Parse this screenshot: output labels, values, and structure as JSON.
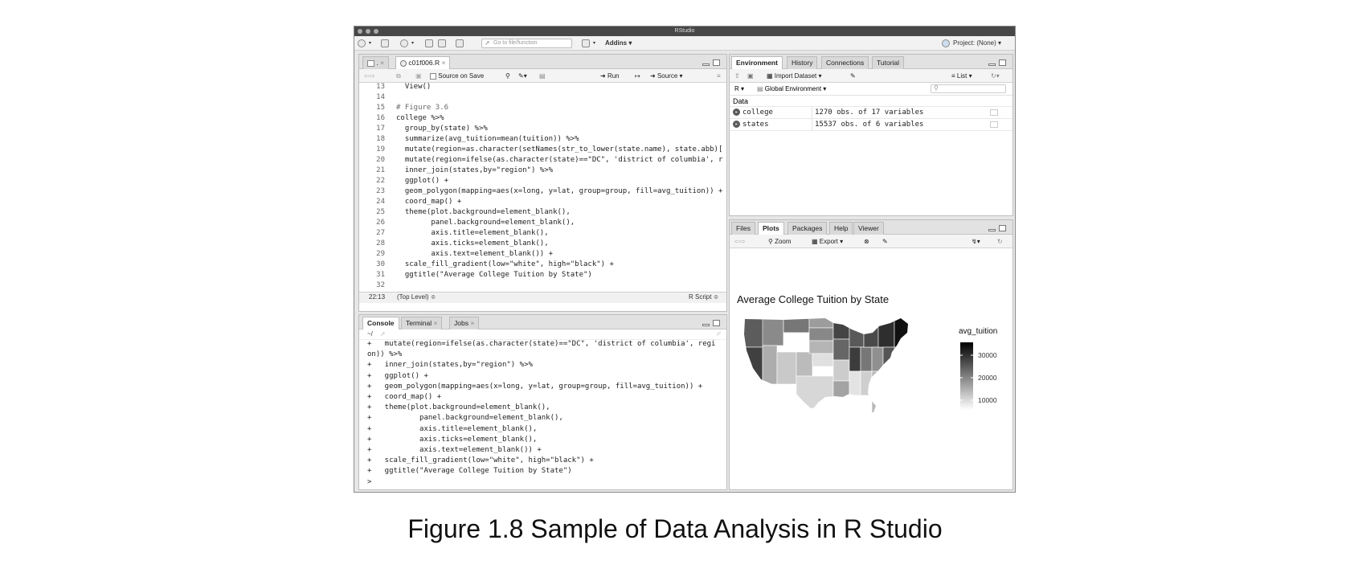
{
  "window_title": "RStudio",
  "toolbar": {
    "go_to_placeholder": "Go to file/function",
    "addins": "Addins",
    "project": "Project: (None)"
  },
  "source_pane": {
    "tabs": [
      ".",
      "c01f006.R"
    ],
    "source_on_save": "Source on Save",
    "run": "Run",
    "source": "Source",
    "lines": [
      {
        "n": "13",
        "t": "  View()"
      },
      {
        "n": "14",
        "t": ""
      },
      {
        "n": "15",
        "t": "# Figure 3.6"
      },
      {
        "n": "16",
        "t": "college %>%"
      },
      {
        "n": "17",
        "t": "  group_by(state) %>%"
      },
      {
        "n": "18",
        "t": "  summarize(avg_tuition=mean(tuition)) %>%"
      },
      {
        "n": "19",
        "t": "  mutate(region=as.character(setNames(str_to_lower(state.name), state.abb)["
      },
      {
        "n": "20",
        "t": "  mutate(region=ifelse(as.character(state)==\"DC\", 'district of columbia', r"
      },
      {
        "n": "21",
        "t": "  inner_join(states,by=\"region\") %>%"
      },
      {
        "n": "22",
        "t": "  ggplot() +"
      },
      {
        "n": "23",
        "t": "  geom_polygon(mapping=aes(x=long, y=lat, group=group, fill=avg_tuition)) +"
      },
      {
        "n": "24",
        "t": "  coord_map() +"
      },
      {
        "n": "25",
        "t": "  theme(plot.background=element_blank(),"
      },
      {
        "n": "26",
        "t": "        panel.background=element_blank(),"
      },
      {
        "n": "27",
        "t": "        axis.title=element_blank(),"
      },
      {
        "n": "28",
        "t": "        axis.ticks=element_blank(),"
      },
      {
        "n": "29",
        "t": "        axis.text=element_blank()) +"
      },
      {
        "n": "30",
        "t": "  scale_fill_gradient(low=\"white\", high=\"black\") +"
      },
      {
        "n": "31",
        "t": "  ggtitle(\"Average College Tuition by State\")"
      },
      {
        "n": "32",
        "t": ""
      }
    ],
    "cursor_pos": "22:13",
    "scope": "(Top Level) ≑",
    "file_type": "R Script ≑"
  },
  "console_pane": {
    "tabs": [
      "Console",
      "Terminal",
      "Jobs"
    ],
    "path": "~/",
    "lines": [
      "+   mutate(region=ifelse(as.character(state)==\"DC\", 'district of columbia', regi",
      "on)) %>%",
      "+   inner_join(states,by=\"region\") %>%",
      "+   ggplot() +",
      "+   geom_polygon(mapping=aes(x=long, y=lat, group=group, fill=avg_tuition)) +",
      "+   coord_map() +",
      "+   theme(plot.background=element_blank(),",
      "+           panel.background=element_blank(),",
      "+           axis.title=element_blank(),",
      "+           axis.ticks=element_blank(),",
      "+           axis.text=element_blank()) +",
      "+   scale_fill_gradient(low=\"white\", high=\"black\") +",
      "+   ggtitle(\"Average College Tuition by State\")",
      ">"
    ]
  },
  "env_pane": {
    "tabs": [
      "Environment",
      "History",
      "Connections",
      "Tutorial"
    ],
    "import_dataset": "Import Dataset",
    "list_view": "List",
    "lang": "R",
    "scope": "Global Environment",
    "section": "Data",
    "rows": [
      {
        "name": "college",
        "desc": "1270 obs. of 17 variables"
      },
      {
        "name": "states",
        "desc": "15537 obs. of 6 variables"
      }
    ]
  },
  "plots_pane": {
    "tabs": [
      "Files",
      "Plots",
      "Packages",
      "Help",
      "Viewer"
    ],
    "zoom": "Zoom",
    "export": "Export",
    "plot_title": "Average College Tuition by State",
    "legend_title": "avg_tuition",
    "legend_ticks": [
      "30000",
      "20000",
      "10000"
    ]
  },
  "caption": "Figure 1.8 Sample of Data Analysis in R Studio"
}
